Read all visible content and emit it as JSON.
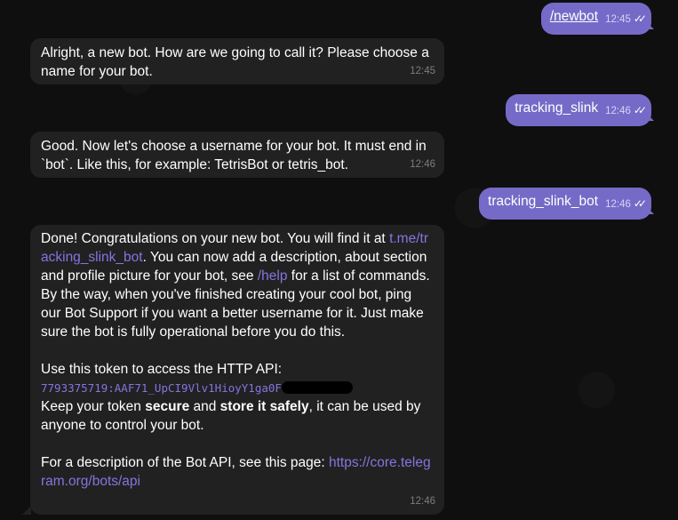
{
  "messages": {
    "m1": {
      "text": "/newbot",
      "time": "12:45"
    },
    "m2": {
      "text": "Alright, a new bot. How are we going to call it? Please choose a name for your bot.",
      "time": "12:45"
    },
    "m3": {
      "text": "tracking_slink",
      "time": "12:46"
    },
    "m4": {
      "text": "Good. Now let's choose a username for your bot. It must end in `bot`. Like this, for example: TetrisBot or tetris_bot.",
      "time": "12:46"
    },
    "m5": {
      "text": "tracking_slink_bot",
      "time": "12:46"
    },
    "m6": {
      "p1_a": "Done! Congratulations on your new bot. You will find it at ",
      "p1_link": "t.me/tracking_slink_bot",
      "p1_b": ". You can now add a description, about section and profile picture for your bot, see ",
      "p1_help": "/help",
      "p1_c": " for a list of commands. By the way, when you've finished creating your cool bot, ping our Bot Support if you want a better username for it. Just make sure the bot is fully operational before you do this.",
      "p2_label": "Use this token to access the HTTP API:",
      "token": "7793375719:AAF71_UpCI9Vlv1HioyY1ga0F",
      "p3_a": "Keep your token ",
      "p3_secure": "secure",
      "p3_b": " and ",
      "p3_store": "store it safely",
      "p3_c": ", it can be used by anyone to control your bot.",
      "p4_a": "For a description of the Bot API, see this page: ",
      "p4_link": "https://core.telegram.org/bots/api",
      "time": "12:46"
    }
  },
  "icons": {
    "read_check": "double-check-icon"
  },
  "colors": {
    "outgoing_bubble": "#766ac8",
    "incoming_bubble": "#212121",
    "link": "#8774e1",
    "background": "#0f0f0f"
  }
}
